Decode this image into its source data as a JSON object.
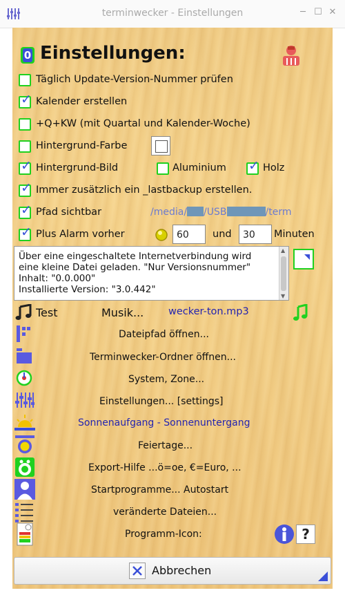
{
  "window": {
    "title": "terminwecker - Einstellungen"
  },
  "header": {
    "title": "Einstellungen:",
    "badge": "0"
  },
  "options": {
    "update_check": {
      "label": "Täglich Update-Version-Nummer prüfen",
      "checked": false
    },
    "calendar": {
      "label": "Kalender erstellen",
      "checked": true
    },
    "q_kw": {
      "label": "+Q+KW   (mit Quartal und Kalender-Woche)",
      "checked": false
    },
    "bg_color": {
      "label": "Hintergrund-Farbe",
      "checked": false
    },
    "bg_image": {
      "label": "Hintergrund-Bild",
      "checked": true
    },
    "aluminium": {
      "label": "Aluminium",
      "checked": false
    },
    "holz": {
      "label": "Holz",
      "checked": true
    },
    "lastbackup": {
      "label": "Immer zusätzlich ein _lastbackup erstellen.",
      "checked": true
    },
    "path_visible": {
      "label": "Pfad sichtbar",
      "checked": true
    },
    "alarm_before": {
      "label": "Plus Alarm vorher",
      "checked": true
    }
  },
  "path": {
    "part1": "/media/",
    "part2": "/USB",
    "part3": "/term"
  },
  "alarm": {
    "value1": "60",
    "und_label": "und",
    "value2": "30",
    "unit_label": "Minuten"
  },
  "info_text": [
    "Über eine eingeschaltete Internetverbindung wird",
    "eine kleine Datei geladen.  \"Nur Versionsnummer\"",
    "Inhalt: \"0.0.000\"",
    "Installierte Version: \"3.0.442\""
  ],
  "sound": {
    "test_label": "Test",
    "musik_label": "Musik...",
    "file": "wecker-ton.mp3"
  },
  "actions": {
    "dateipfad": "Dateipfad öffnen...",
    "ordner": "Terminwecker-Ordner öffnen...",
    "zone": "System, Zone...",
    "settings": "Einstellungen...    [settings]",
    "sonne": "Sonnenaufgang - Sonnenuntergang",
    "feiertage": "Feiertage...",
    "export": "Export-Hilfe    ...ö=oe, €=Euro, ...",
    "startprogramme": "Startprogramme...    Autostart",
    "dateien": "veränderte Dateien...",
    "icon": "Programm-Icon:"
  },
  "help": {
    "question": "?"
  },
  "cancel": {
    "label": "Abbrechen"
  },
  "colors": {
    "checkbox_border": "#1fd11f",
    "check_mark": "#3a55d8",
    "link_blue": "#2424b0",
    "path_text": "#6b7bd0",
    "wood": "#f3cf87"
  }
}
